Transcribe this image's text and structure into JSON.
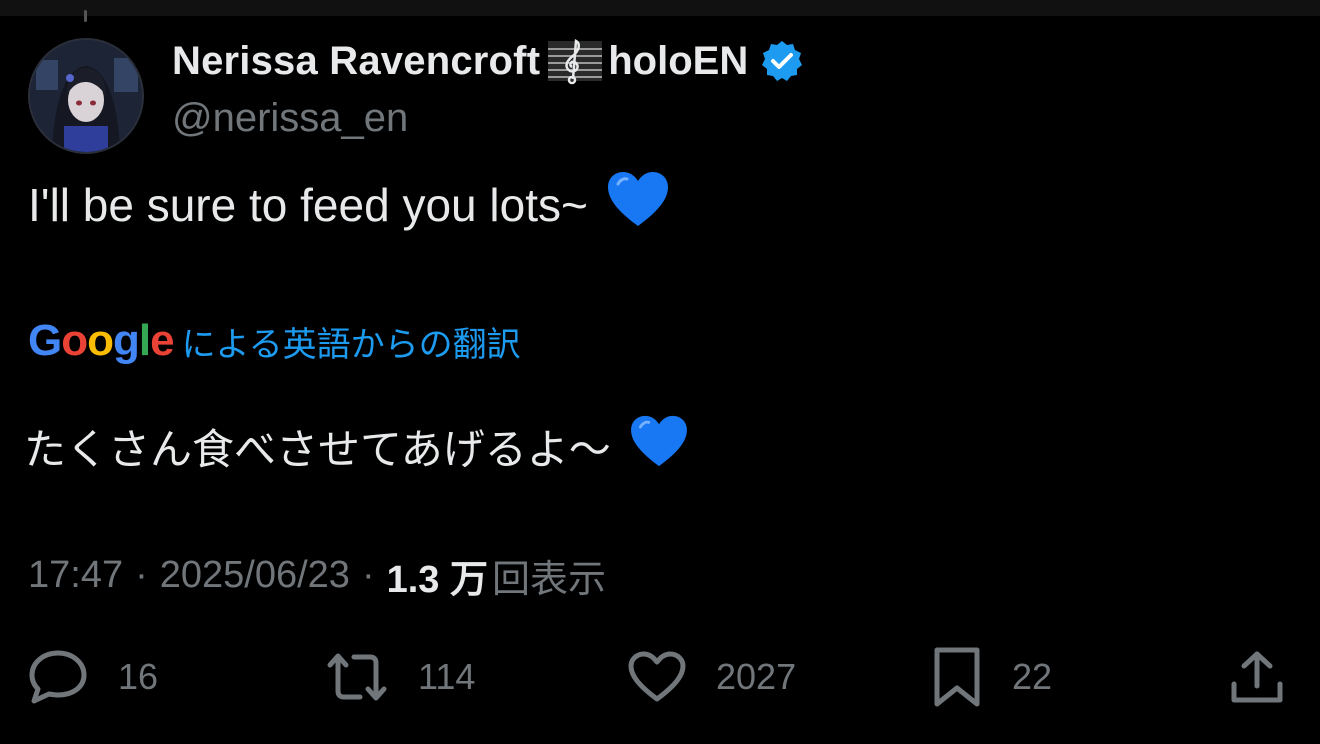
{
  "author": {
    "display_name": "Nerissa Ravencroft",
    "name_emoji_icon": "musical-score-icon",
    "name_suffix": "holoEN",
    "verified_icon": "verified-badge-icon",
    "handle": "@nerissa_en"
  },
  "tweet": {
    "text": "I'll be sure to feed you lots~",
    "emoji": "💙"
  },
  "translation": {
    "google_letters": [
      "G",
      "o",
      "o",
      "g",
      "l",
      "e"
    ],
    "label": "による英語からの翻訳",
    "text": "たくさん食べさせてあげるよ～",
    "emoji": "💙"
  },
  "meta": {
    "time": "17:47",
    "separator": "·",
    "date": "2025/06/23",
    "views_count": "1.3 万",
    "views_label": "回表示"
  },
  "actions": {
    "replies": {
      "icon": "reply-bubble-icon",
      "count": "16"
    },
    "retweets": {
      "icon": "retweet-icon",
      "count": "114"
    },
    "likes": {
      "icon": "heart-outline-icon",
      "count": "2027"
    },
    "bookmarks": {
      "icon": "bookmark-icon",
      "count": "22"
    },
    "share": {
      "icon": "share-upload-icon"
    }
  },
  "colors": {
    "background": "#000000",
    "text_primary": "#e7e9ea",
    "text_secondary": "#71767b",
    "link_blue": "#1d9bf0",
    "verified_blue": "#1d9bf0",
    "heart_blue": "#1877f2"
  }
}
